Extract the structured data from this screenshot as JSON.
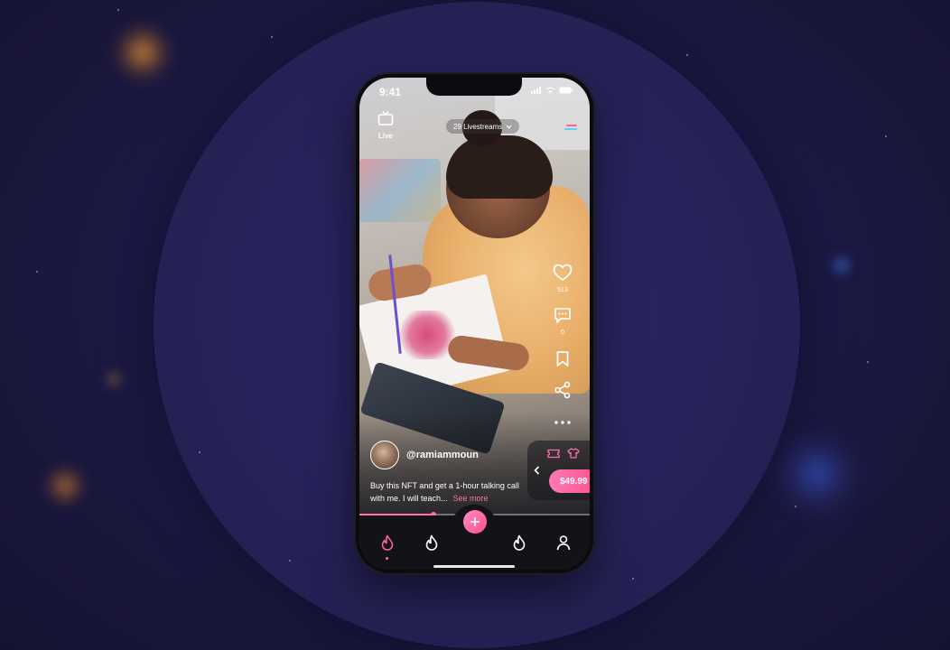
{
  "status_bar": {
    "time": "9:41"
  },
  "top_bar": {
    "live_label": "Live",
    "livestreams_label": "29 Livestreams"
  },
  "actions": {
    "likes_count": "513",
    "comments_count": "0"
  },
  "post": {
    "username": "@ramiammoun",
    "caption": "Buy this NFT and get a 1-hour talking call with me. I will teach...",
    "see_more": "See more",
    "progress": 0.32
  },
  "shop": {
    "price": "$49.99"
  },
  "icons": [
    "tv-icon",
    "chevron-down-icon",
    "menu-icon",
    "heart-icon",
    "comment-icon",
    "bookmark-icon",
    "share-icon",
    "more-icon",
    "chevron-left-icon",
    "ticket-icon",
    "shirt-icon",
    "flame-icon",
    "plus-icon",
    "profile-icon"
  ],
  "colors": {
    "accent": "#ff5f9e",
    "background": "#221d4a"
  }
}
